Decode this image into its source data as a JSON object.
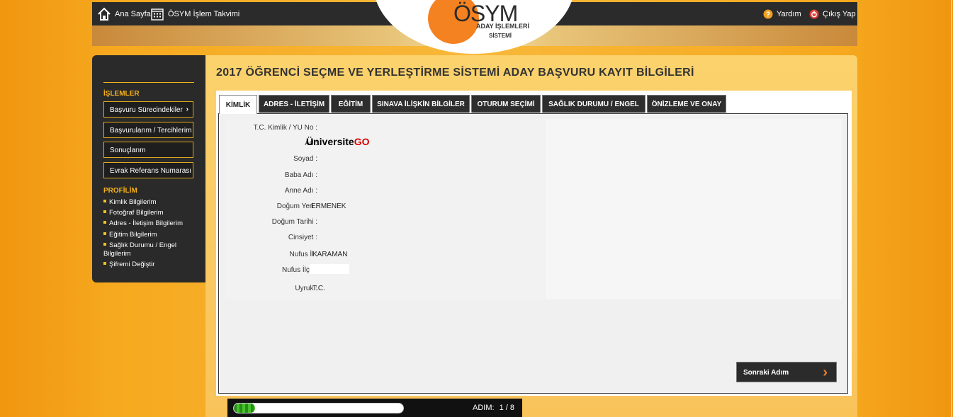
{
  "topbar": {
    "home_label": "Ana Sayfa",
    "calendar_label": "ÖSYM İşlem Takvimi",
    "help_label": "Yardım",
    "logout_label": "Çıkış Yap"
  },
  "logo": {
    "brand": "ÖSYM",
    "line1": "ADAY İŞLEMLERİ",
    "line2": "SİSTEMİ"
  },
  "sidebar": {
    "section1_title": "İŞLEMLER",
    "buttons": [
      {
        "label": "Başvuru Sürecindekiler",
        "arrow": "›"
      },
      {
        "label": "Başvurularım / Tercihlerim"
      },
      {
        "label": "Sonuçlarım"
      },
      {
        "label": "Evrak Referans Numarası"
      }
    ],
    "section2_title": "PROFİLİM",
    "profile_links": [
      "Kimlik Bilgilerim",
      "Fotoğraf Bilgilerim",
      "Adres - İletişim Bilgilerim",
      "Eğitim Bilgilerim",
      "Sağlık Durumu / Engel Bilgilerim",
      "Şifremi Değiştir"
    ]
  },
  "main": {
    "title": "2017 ÖĞRENCİ SEÇME VE YERLEŞTİRME SİSTEMİ ADAY BAŞVURU KAYIT BİLGİLERİ",
    "tabs": [
      "KİMLİK",
      "ADRES - İLETİŞİM",
      "EĞİTİM",
      "SINAVA İLİŞKİN BİLGİLER",
      "OTURUM SEÇİMİ",
      "SAĞLIK DURUMU / ENGEL",
      "ÖNİZLEME VE ONAY"
    ],
    "active_tab": "KİMLİK",
    "fields": [
      {
        "label": "T.C. Kimlik / YU No :",
        "value": ""
      },
      {
        "label": "Ad :",
        "value": ""
      },
      {
        "label": "Soyad :",
        "value": ""
      },
      {
        "label": "Baba Adı :",
        "value": ""
      },
      {
        "label": "Anne Adı :",
        "value": ""
      },
      {
        "label": "Doğum Yeri :",
        "value": "ERMENEK"
      },
      {
        "label": "Doğum Tarihi :",
        "value": ""
      },
      {
        "label": "Cinsiyet :",
        "value": ""
      },
      {
        "label": "Nufus İl :",
        "value": "KARAMAN"
      },
      {
        "label": "Nufus İlçe :",
        "value": ""
      },
      {
        "label": "Uyruk :",
        "value": "T.C."
      }
    ],
    "watermark_brand": {
      "part1": "Üniversite",
      "part2": "GO"
    },
    "next_button": {
      "label": "Sonraki Adım"
    }
  },
  "progress": {
    "step_label": "ADIM:",
    "step_value": "1 / 8",
    "fraction": 0.125
  },
  "colors": {
    "accent_orange": "#f58220",
    "sidebar_yellow": "#f7b21a",
    "dark": "#2b2b2b"
  }
}
